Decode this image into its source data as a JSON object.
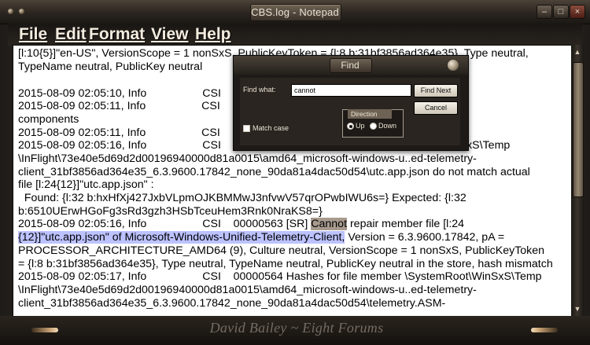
{
  "window": {
    "title": "CBS.log - Notepad"
  },
  "menu": {
    "file": "File",
    "edit": "Edit",
    "format": "Format",
    "view": "View",
    "help": "Help"
  },
  "editor": {
    "lines": [
      "[l:10{5}]\"en-US\", VersionScope = 1 nonSxS, PublicKeyToken = {l:8 b:31bf3856ad364e35}, Type neutral,",
      "TypeName neutral, PublicKey neutral",
      "",
      "2015-08-09 02:05:10, Info                  CSI",
      "2015-08-09 02:05:11, Info                  CSI                                                              0000064)",
      "components",
      "2015-08-09 02:05:11, Info                  CSI                                                              transaction",
      "2015-08-09 02:05:16, Info                  CSI                                                              Root\\WinSxS\\Temp",
      "\\InFlight\\73e40e5d69d2d00196940000d81a0015\\amd64_microsoft-windows-u..ed-telemetry-",
      "client_31bf3856ad364e35_6.3.9600.17842_none_90da81a4dac50d54\\utc.app.json do not match actual",
      "file [l:24{12}]\"utc.app.json\" :",
      "  Found: {l:32 b:hxHfXj427JxbVLpmOJKBMMwJ3nfvwV57qrOPwbIWU6s=} Expected: {l:32",
      "b:6510UErwHGoFg3sRd3gzh3HSbTceuHem3Rnk0NraKS8=}",
      "2015-08-09 02:05:16, Info                  CSI    00000563 [SR] ",
      "",
      "PROCESSOR_ARCHITECTURE_AMD64 (9), Culture neutral, VersionScope = 1 nonSxS, PublicKeyToken",
      "= {l:8 b:31bf3856ad364e35}, Type neutral, TypeName neutral, PublicKey neutral in the store, hash mismatch",
      "2015-08-09 02:05:17, Info                  CSI    00000564 Hashes for file member \\SystemRoot\\WinSxS\\Temp",
      "\\InFlight\\73e40e5d69d2d00196940000d81a0015\\amd64_microsoft-windows-u..ed-telemetry-",
      "client_31bf3856ad364e35_6.3.9600.17842_none_90da81a4dac50d54\\telemetry.ASM-"
    ],
    "line14_cannot": "Cannot",
    "line14_rest": " repair member file [l:24",
    "line15_selected": "{12}]\"utc.app.json\" of Microsoft-Windows-Unified-Telemetry-Client,",
    "line15_rest": " Version = 6.3.9600.17842, pA ="
  },
  "find_dialog": {
    "title": "Find",
    "find_what_label": "Find what:",
    "find_what_value": "cannot",
    "find_next_label": "Find Next",
    "cancel_label": "Cancel",
    "direction_label": "Direction",
    "up_label": "Up",
    "down_label": "Down",
    "direction_selected": "Up",
    "match_case_label": "Match case",
    "match_case_checked": false
  },
  "footer": {
    "signature": "David Bailey ~ Eight Forums"
  },
  "colors": {
    "selection": "#bcc2ff",
    "find_highlight": "#a79a8e",
    "frame": "#3b342c"
  }
}
